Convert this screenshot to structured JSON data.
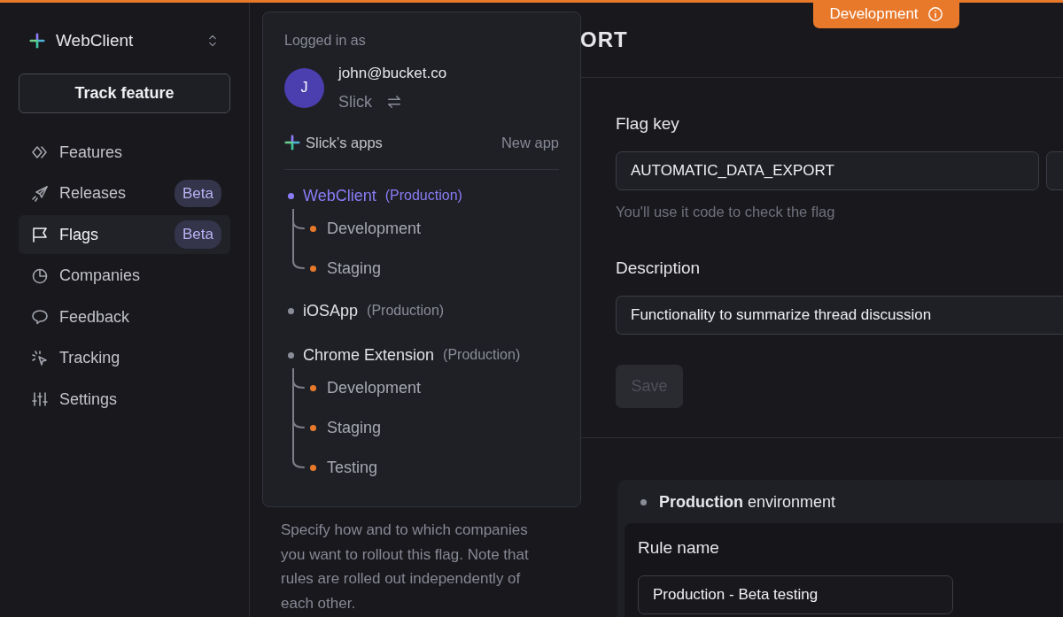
{
  "sidebar": {
    "app_name": "WebClient",
    "track_button": "Track feature",
    "items": [
      {
        "label": "Features",
        "selected": false
      },
      {
        "label": "Releases",
        "badge": "Beta",
        "selected": false
      },
      {
        "label": "Flags",
        "badge": "Beta",
        "selected": true
      },
      {
        "label": "Companies",
        "selected": false
      },
      {
        "label": "Feedback",
        "selected": false
      },
      {
        "label": "Tracking",
        "selected": false
      },
      {
        "label": "Settings",
        "selected": false
      }
    ]
  },
  "environment_badge": "Development",
  "header": {
    "title": "ORT"
  },
  "form": {
    "flag_key_label": "Flag key",
    "flag_key_value": "AUTOMATIC_DATA_EXPORT",
    "flag_key_hint": "You'll use it code to check the flag",
    "description_label": "Description",
    "description_value": "Functionality to summarize thread discussion",
    "save_button": "Save",
    "save_disabled": true
  },
  "rules_help": "Specify how and to which companies you want to rollout this flag. Note that rules are rolled out independently of each other.",
  "environment_card": {
    "title": "**Production** environment",
    "rule_name_label": "Rule name",
    "rule_name_value": "Production - Beta testing"
  },
  "account_menu": {
    "logged_in_label": "Logged in as",
    "avatar_initial": "J",
    "email": "john@bucket.co",
    "org": "Slick",
    "apps_title": "Slick’s apps",
    "new_app": "New app",
    "apps": [
      {
        "name": "WebClient",
        "env": "(Production)",
        "color": "#8b7cf6",
        "selected": true,
        "children": [
          {
            "name": "Development",
            "color": "#e8792b"
          },
          {
            "name": "Staging",
            "color": "#e8792b"
          }
        ]
      },
      {
        "name": "iOSApp",
        "env": "(Production)",
        "color": "#8a8d98",
        "selected": false
      },
      {
        "name": "Chrome Extension",
        "env": "(Production)",
        "color": "#8a8d98",
        "selected": false,
        "children": [
          {
            "name": "Development",
            "color": "#e8792b"
          },
          {
            "name": "Staging",
            "color": "#e8792b"
          },
          {
            "name": "Testing",
            "color": "#e8792b"
          }
        ]
      }
    ]
  }
}
